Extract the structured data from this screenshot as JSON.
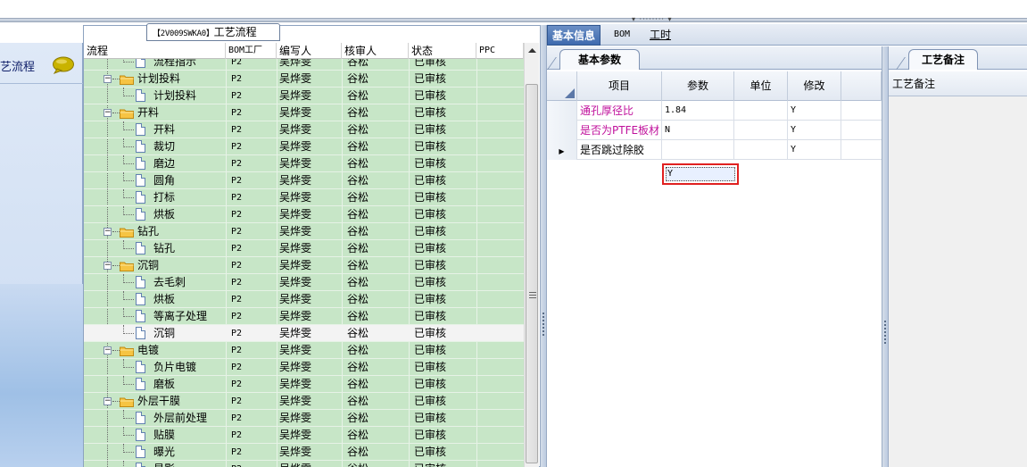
{
  "left_nav": {
    "item_label": "艺流程",
    "icon": "speech-bubble-icon"
  },
  "tree_panel": {
    "title_code": "【2V009SWKA0】",
    "title_text": "工艺流程",
    "columns": [
      "流程",
      "BOM工厂",
      "编写人",
      "核审人",
      "状态",
      "PPC"
    ],
    "rows": [
      {
        "level": 2,
        "type": "doc",
        "name": "流程指示",
        "bom": "P2",
        "writer": "吴烨雯",
        "reviewer": "谷松",
        "status": "已审核",
        "ppc": "",
        "partial": true
      },
      {
        "level": 1,
        "type": "folder",
        "name": "计划投料",
        "bom": "P2",
        "writer": "吴烨雯",
        "reviewer": "谷松",
        "status": "已审核",
        "ppc": ""
      },
      {
        "level": 2,
        "type": "doc",
        "name": "计划投料",
        "bom": "P2",
        "writer": "吴烨雯",
        "reviewer": "谷松",
        "status": "已审核",
        "ppc": ""
      },
      {
        "level": 1,
        "type": "folder",
        "name": "开料",
        "bom": "P2",
        "writer": "吴烨雯",
        "reviewer": "谷松",
        "status": "已审核",
        "ppc": ""
      },
      {
        "level": 2,
        "type": "doc",
        "name": "开料",
        "bom": "P2",
        "writer": "吴烨雯",
        "reviewer": "谷松",
        "status": "已审核",
        "ppc": ""
      },
      {
        "level": 2,
        "type": "doc",
        "name": "裁切",
        "bom": "P2",
        "writer": "吴烨雯",
        "reviewer": "谷松",
        "status": "已审核",
        "ppc": ""
      },
      {
        "level": 2,
        "type": "doc",
        "name": "磨边",
        "bom": "P2",
        "writer": "吴烨雯",
        "reviewer": "谷松",
        "status": "已审核",
        "ppc": ""
      },
      {
        "level": 2,
        "type": "doc",
        "name": "圆角",
        "bom": "P2",
        "writer": "吴烨雯",
        "reviewer": "谷松",
        "status": "已审核",
        "ppc": ""
      },
      {
        "level": 2,
        "type": "doc",
        "name": "打标",
        "bom": "P2",
        "writer": "吴烨雯",
        "reviewer": "谷松",
        "status": "已审核",
        "ppc": ""
      },
      {
        "level": 2,
        "type": "doc",
        "name": "烘板",
        "bom": "P2",
        "writer": "吴烨雯",
        "reviewer": "谷松",
        "status": "已审核",
        "ppc": ""
      },
      {
        "level": 1,
        "type": "folder",
        "name": "钻孔",
        "bom": "P2",
        "writer": "吴烨雯",
        "reviewer": "谷松",
        "status": "已审核",
        "ppc": ""
      },
      {
        "level": 2,
        "type": "doc",
        "name": "钻孔",
        "bom": "P2",
        "writer": "吴烨雯",
        "reviewer": "谷松",
        "status": "已审核",
        "ppc": ""
      },
      {
        "level": 1,
        "type": "folder",
        "name": "沉铜",
        "bom": "P2",
        "writer": "吴烨雯",
        "reviewer": "谷松",
        "status": "已审核",
        "ppc": ""
      },
      {
        "level": 2,
        "type": "doc",
        "name": "去毛刺",
        "bom": "P2",
        "writer": "吴烨雯",
        "reviewer": "谷松",
        "status": "已审核",
        "ppc": ""
      },
      {
        "level": 2,
        "type": "doc",
        "name": "烘板",
        "bom": "P2",
        "writer": "吴烨雯",
        "reviewer": "谷松",
        "status": "已审核",
        "ppc": ""
      },
      {
        "level": 2,
        "type": "doc",
        "name": "等离子处理",
        "bom": "P2",
        "writer": "吴烨雯",
        "reviewer": "谷松",
        "status": "已审核",
        "ppc": ""
      },
      {
        "level": 2,
        "type": "doc",
        "name": "沉铜",
        "bom": "P2",
        "writer": "吴烨雯",
        "reviewer": "谷松",
        "status": "已审核",
        "ppc": "",
        "selected": true
      },
      {
        "level": 1,
        "type": "folder",
        "name": "电镀",
        "bom": "P2",
        "writer": "吴烨雯",
        "reviewer": "谷松",
        "status": "已审核",
        "ppc": ""
      },
      {
        "level": 2,
        "type": "doc",
        "name": "负片电镀",
        "bom": "P2",
        "writer": "吴烨雯",
        "reviewer": "谷松",
        "status": "已审核",
        "ppc": ""
      },
      {
        "level": 2,
        "type": "doc",
        "name": "磨板",
        "bom": "P2",
        "writer": "吴烨雯",
        "reviewer": "谷松",
        "status": "已审核",
        "ppc": ""
      },
      {
        "level": 1,
        "type": "folder",
        "name": "外层干膜",
        "bom": "P2",
        "writer": "吴烨雯",
        "reviewer": "谷松",
        "status": "已审核",
        "ppc": ""
      },
      {
        "level": 2,
        "type": "doc",
        "name": "外层前处理",
        "bom": "P2",
        "writer": "吴烨雯",
        "reviewer": "谷松",
        "status": "已审核",
        "ppc": ""
      },
      {
        "level": 2,
        "type": "doc",
        "name": "贴膜",
        "bom": "P2",
        "writer": "吴烨雯",
        "reviewer": "谷松",
        "status": "已审核",
        "ppc": ""
      },
      {
        "level": 2,
        "type": "doc",
        "name": "曝光",
        "bom": "P2",
        "writer": "吴烨雯",
        "reviewer": "谷松",
        "status": "已审核",
        "ppc": ""
      },
      {
        "level": 2,
        "type": "doc",
        "name": "显影",
        "bom": "P2",
        "writer": "吴烨雯",
        "reviewer": "谷松",
        "status": "已审核",
        "ppc": "",
        "partial": true
      }
    ]
  },
  "right_panel": {
    "tabs": [
      {
        "label": "基本信息",
        "active": true
      },
      {
        "label": "BOM",
        "active": false
      },
      {
        "label": "工时",
        "active": false,
        "underline_first": true
      }
    ],
    "basic_tab_label": "基本参数",
    "param_columns": [
      "项目",
      "参数",
      "单位",
      "修改"
    ],
    "param_rows": [
      {
        "item": "通孔厚径比",
        "param": "1.84",
        "unit": "",
        "modify": "Y",
        "pink": true,
        "current": false
      },
      {
        "item": "是否为PTFE板材",
        "param": "N",
        "unit": "",
        "modify": "Y",
        "pink": true,
        "current": false
      },
      {
        "item": "是否跳过除胶",
        "param": "Y",
        "unit": "",
        "modify": "Y",
        "pink": false,
        "current": true
      }
    ],
    "colors": {
      "accent": "#3e6aae",
      "highlight_border": "#e02020",
      "pink_label": "#c0119c",
      "tree_bg": "#c7e6c7"
    }
  },
  "remark_panel": {
    "tab_label": "工艺备注",
    "field_label": "工艺备注"
  }
}
